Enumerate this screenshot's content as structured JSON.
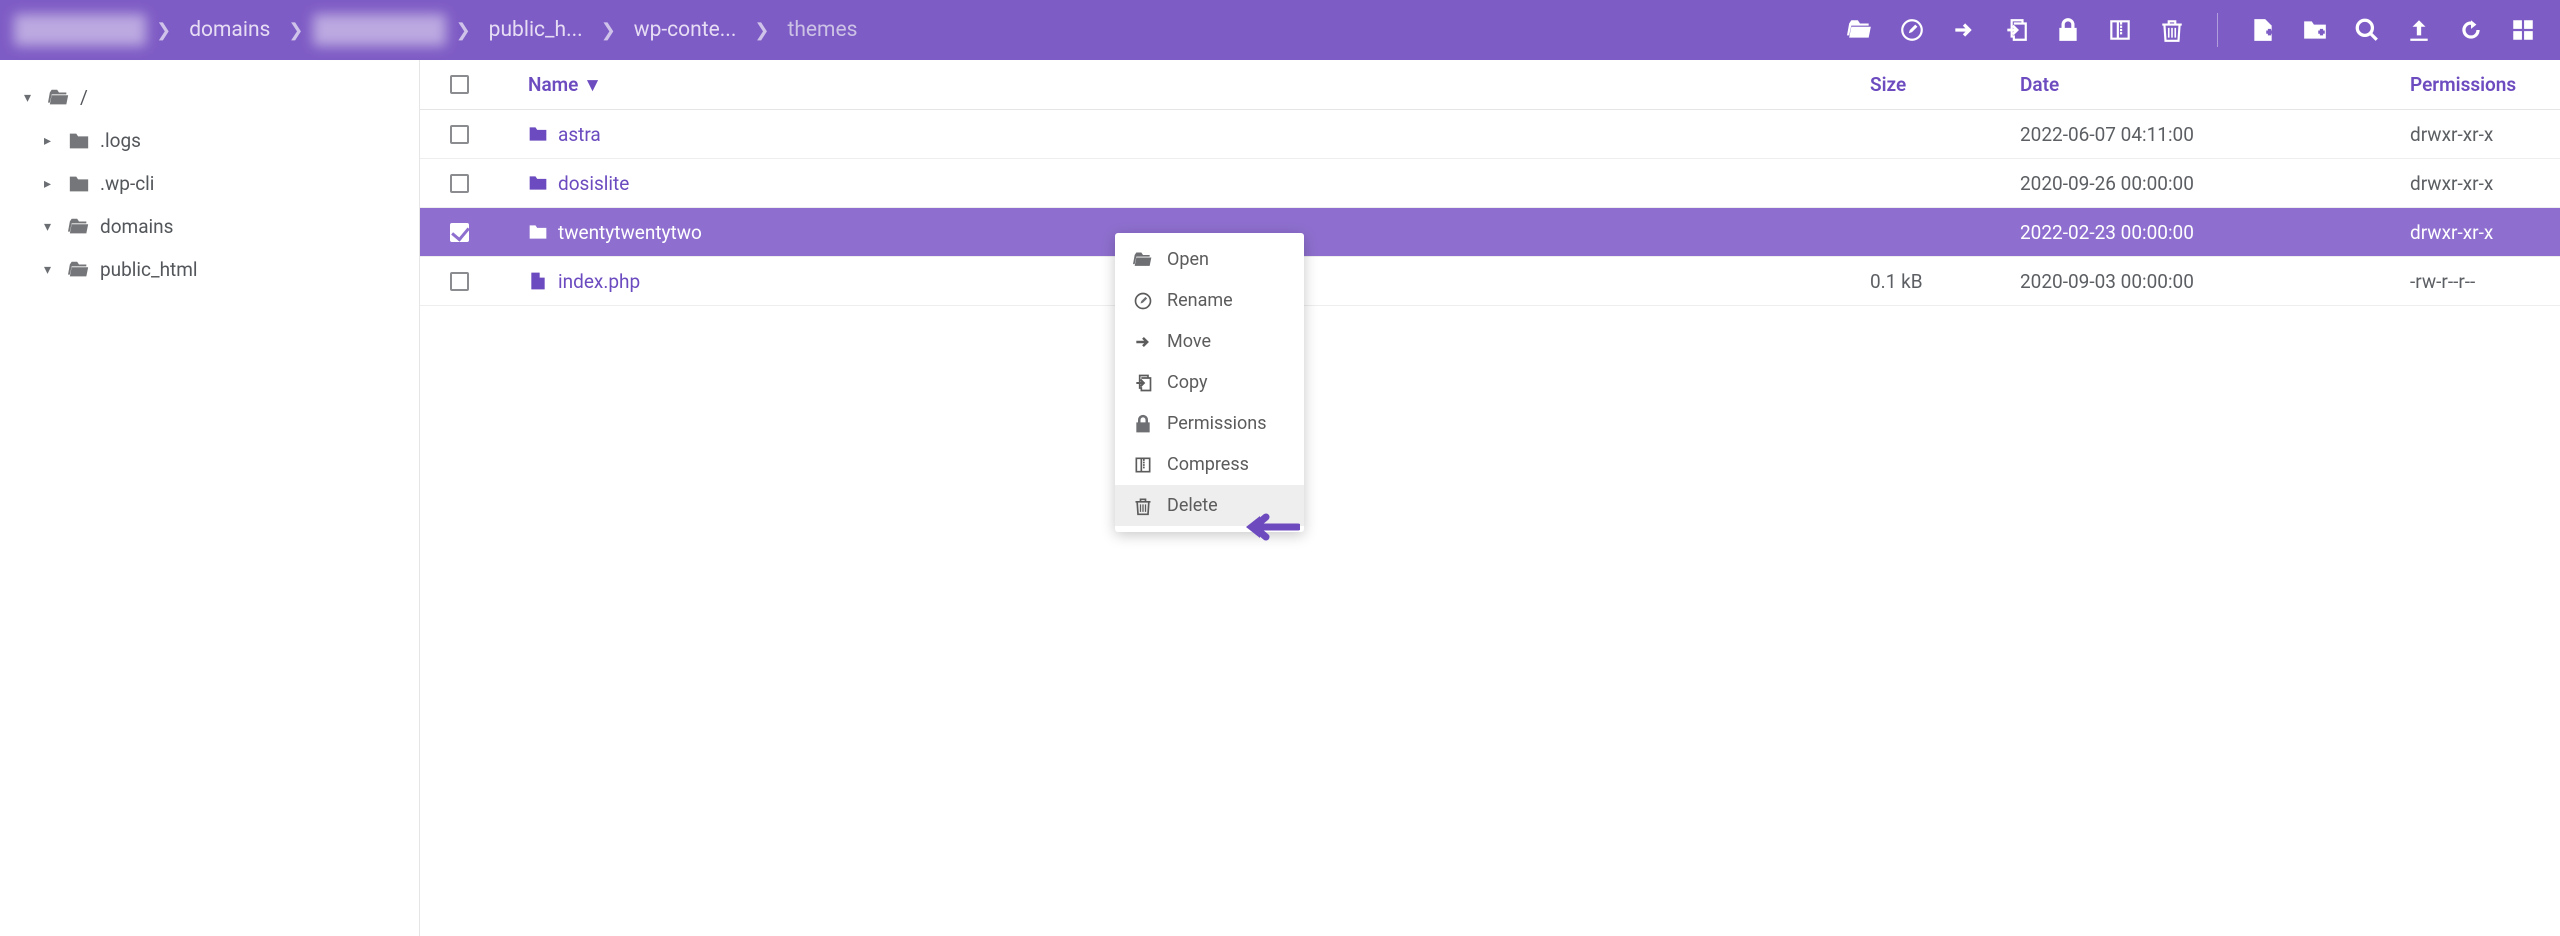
{
  "breadcrumb": [
    {
      "label": "",
      "blurred": true
    },
    {
      "label": "domains"
    },
    {
      "label": "",
      "blurred": true
    },
    {
      "label": "public_h..."
    },
    {
      "label": "wp-conte..."
    },
    {
      "label": "themes",
      "last": true
    }
  ],
  "sidebar": {
    "root": "/",
    "items": [
      {
        "label": ".logs",
        "expanded": false,
        "type": "folder"
      },
      {
        "label": ".wp-cli",
        "expanded": false,
        "type": "folder"
      },
      {
        "label": "domains",
        "expanded": true,
        "type": "folder-open"
      },
      {
        "label": "public_html",
        "expanded": true,
        "type": "folder-link"
      }
    ]
  },
  "columns": {
    "name": "Name ▼",
    "size": "Size",
    "date": "Date",
    "permissions": "Permissions"
  },
  "rows": [
    {
      "name": "astra",
      "type": "folder",
      "size": "",
      "date": "2022-06-07 04:11:00",
      "perm": "drwxr-xr-x",
      "selected": false
    },
    {
      "name": "dosislite",
      "type": "folder",
      "size": "",
      "date": "2020-09-26 00:00:00",
      "perm": "drwxr-xr-x",
      "selected": false
    },
    {
      "name": "twentytwentytwo",
      "type": "folder",
      "size": "",
      "date": "2022-02-23 00:00:00",
      "perm": "drwxr-xr-x",
      "selected": true
    },
    {
      "name": "index.php",
      "type": "file",
      "size": "0.1 kB",
      "date": "2020-09-03 00:00:00",
      "perm": "-rw-r--r--",
      "selected": false
    }
  ],
  "context_menu": {
    "items": [
      {
        "label": "Open",
        "icon": "open"
      },
      {
        "label": "Rename",
        "icon": "rename"
      },
      {
        "label": "Move",
        "icon": "move"
      },
      {
        "label": "Copy",
        "icon": "copy"
      },
      {
        "label": "Permissions",
        "icon": "perm"
      },
      {
        "label": "Compress",
        "icon": "compress"
      },
      {
        "label": "Delete",
        "icon": "delete",
        "hover": true
      }
    ]
  },
  "toolbar_icons": [
    "open",
    "edit",
    "move",
    "copy",
    "perm",
    "compress",
    "delete",
    "sep",
    "newfile",
    "newfolder",
    "search",
    "upload",
    "refresh",
    "grid"
  ]
}
